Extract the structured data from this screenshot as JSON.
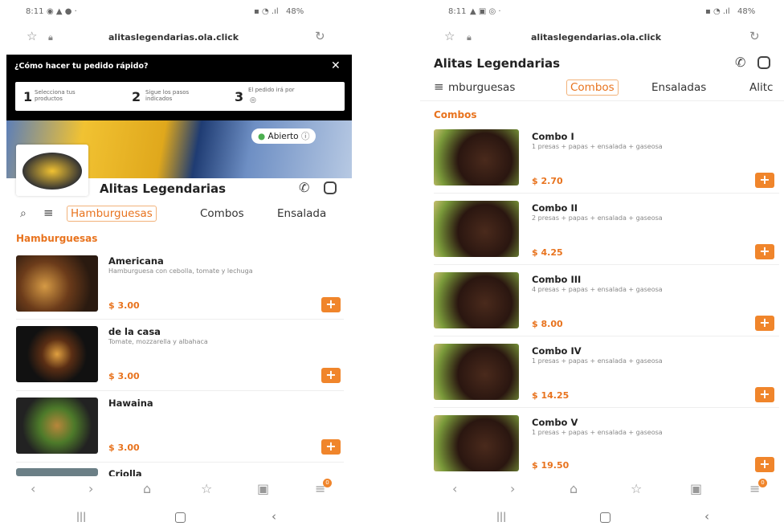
{
  "left": {
    "status": {
      "time": "8:11",
      "battery": "48%"
    },
    "url": "alitaslegendarias.ola.click",
    "howto": {
      "title": "¿Cómo hacer tu pedido rápido?",
      "steps": [
        {
          "num": "1",
          "text": "Selecciona tus productos"
        },
        {
          "num": "2",
          "text": "Sigue los pasos indicados"
        },
        {
          "num": "3",
          "text": "El pedido irá por"
        }
      ]
    },
    "open_badge": "Abierto",
    "store_name": "Alitas Legendarias",
    "tabs": [
      "Hamburguesas",
      "Combos",
      "Ensalada"
    ],
    "section_title": "Hamburguesas",
    "items": [
      {
        "name": "Americana",
        "desc": "Hamburguesa con cebolla, tomate y lechuga",
        "price": "$ 3.00"
      },
      {
        "name": "de la casa",
        "desc": "Tomate, mozzarella y albahaca",
        "price": "$ 3.00"
      },
      {
        "name": "Hawaina",
        "desc": "",
        "price": "$ 3.00"
      },
      {
        "name": "Criolla",
        "desc": "",
        "price": ""
      }
    ],
    "cart_count": "0"
  },
  "right": {
    "status": {
      "time": "8:11",
      "battery": "48%"
    },
    "url": "alitaslegendarias.ola.click",
    "store_name": "Alitas Legendarias",
    "tabs": [
      "mburguesas",
      "Combos",
      "Ensaladas",
      "Alitc"
    ],
    "section_title": "Combos",
    "items": [
      {
        "name": "Combo I",
        "desc": "1 presas + papas + ensalada + gaseosa",
        "price": "$ 2.70"
      },
      {
        "name": "Combo II",
        "desc": "2 presas + papas + ensalada + gaseosa",
        "price": "$ 4.25"
      },
      {
        "name": "Combo III",
        "desc": "4 presas + papas + ensalada + gaseosa",
        "price": "$ 8.00"
      },
      {
        "name": "Combo IV",
        "desc": "1 presas + papas + ensalada + gaseosa",
        "price": "$ 14.25"
      },
      {
        "name": "Combo V",
        "desc": "1 presas + papas + ensalada + gaseosa",
        "price": "$ 19.50"
      }
    ],
    "cart_count": "0"
  },
  "colors": {
    "accent": "#e8731e",
    "button": "#f0852b",
    "banner_dark": "#000000",
    "open_green": "#4caf50"
  },
  "icons": [
    "star-icon",
    "lock-icon",
    "refresh-icon",
    "close-icon",
    "search-icon",
    "menu-icon",
    "whatsapp-icon",
    "instagram-icon",
    "back-icon",
    "forward-icon",
    "home-icon",
    "bookmark-icon",
    "tabs-icon",
    "cart-icon",
    "recents-icon",
    "circle-home-icon",
    "back-arrow-icon",
    "plus-icon"
  ]
}
